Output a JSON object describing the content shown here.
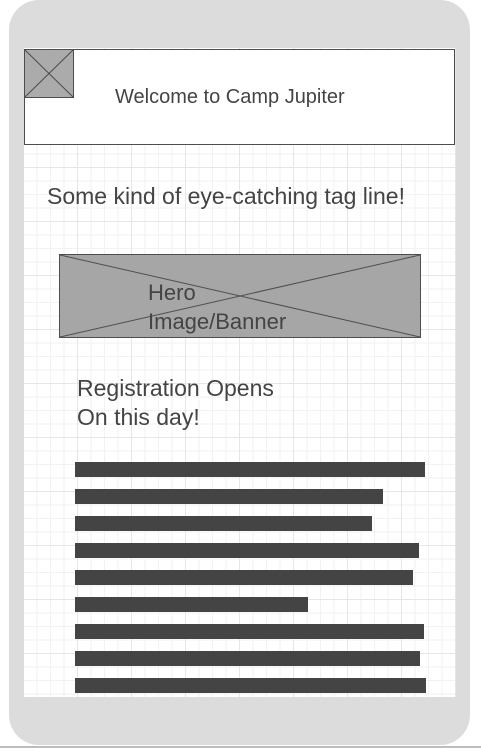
{
  "header": {
    "title": "Welcome to Camp Jupiter",
    "logo_icon": "image-placeholder-icon"
  },
  "tagline": "Some kind of eye-catching tag line!",
  "hero": {
    "label_line1": "Hero",
    "label_line2": "Image/Banner",
    "icon": "image-placeholder-icon"
  },
  "registration": {
    "line1": "Registration Opens",
    "line2": "On this day!"
  },
  "body_text": {
    "line_count": 9,
    "note": ""
  },
  "colors": {
    "device": "#dcdcdc",
    "placeholder": "#a6a6a6",
    "text": "#444444",
    "text_bar": "#444444"
  }
}
